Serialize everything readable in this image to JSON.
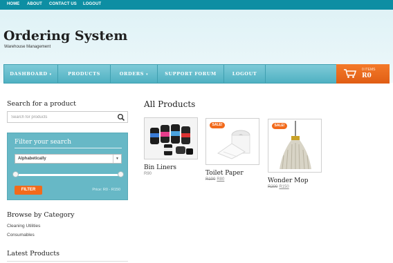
{
  "topnav": [
    "HOME",
    "ABOUT",
    "CONTACT US",
    "LOGOUT"
  ],
  "header": {
    "title": "Ordering System",
    "subtitle": "Warehouse Management"
  },
  "mainnav": [
    {
      "label": "DASHBOARD",
      "has_dropdown": true
    },
    {
      "label": "PRODUCTS",
      "has_dropdown": false
    },
    {
      "label": "ORDERS",
      "has_dropdown": true
    },
    {
      "label": "SUPPORT FORUM",
      "has_dropdown": false
    },
    {
      "label": "LOGOUT",
      "has_dropdown": false
    }
  ],
  "cart": {
    "items": "0 ITEMS",
    "total": "R0",
    "icon": "cart-icon"
  },
  "sidebar": {
    "search_heading": "Search for a product",
    "search_placeholder": "Search for products",
    "filter_title": "Filter your search",
    "sort_value": "Alphabetically",
    "filter_button": "FILTER",
    "price_range": "Price: R0 - R150",
    "browse_heading": "Browse by Category",
    "categories": [
      "Cleaning Utilities",
      "Consumables"
    ],
    "latest_heading": "Latest Products"
  },
  "main": {
    "heading": "All Products",
    "products": [
      {
        "name": "Bin Liners",
        "price": "R90",
        "old_price": "",
        "sale": false
      },
      {
        "name": "Toilet Paper",
        "price": "R80",
        "old_price": "R100",
        "sale": true
      },
      {
        "name": "Wonder Mop",
        "price": "R150",
        "old_price": "R200",
        "sale": true
      }
    ],
    "sale_label": "SALE!"
  },
  "colors": {
    "topbar": "#0d8ea3",
    "nav": "#5db9c9",
    "accent": "#f26a1b"
  }
}
